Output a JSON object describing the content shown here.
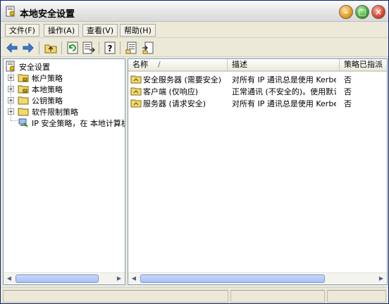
{
  "window": {
    "title": "本地安全设置"
  },
  "menubar": {
    "items": [
      {
        "label": "文件(F)"
      },
      {
        "label": "操作(A)"
      },
      {
        "label": "查看(V)"
      },
      {
        "label": "帮助(H)"
      }
    ]
  },
  "toolbar": {
    "icons": [
      "back-arrow-icon",
      "forward-arrow-icon",
      "up-folder-icon",
      "refresh-icon",
      "export-list-icon",
      "help-icon",
      "properties-icon",
      "import-policy-icon"
    ]
  },
  "tree": {
    "root": "安全设置",
    "items": [
      {
        "label": "帐户策略"
      },
      {
        "label": "本地策略"
      },
      {
        "label": "公钥策略"
      },
      {
        "label": "软件限制策略"
      },
      {
        "label": "IP 安全策略，在 本地计算机"
      }
    ]
  },
  "list": {
    "columns": [
      "名称",
      "描述",
      "策略已指派"
    ],
    "sort_indicator": "/",
    "rows": [
      {
        "name": "安全服务器 (需要安全)",
        "desc": "对所有 IP 通讯总是使用 Kerberos 信任请求安全。",
        "assigned": "否"
      },
      {
        "name": "客户端 (仅响应)",
        "desc": "正常通讯 (不安全的)。使用默认响应规则。",
        "assigned": "否"
      },
      {
        "name": "服务器 (请求安全)",
        "desc": "对所有 IP 通讯总是使用 Kerberos 信任请求安全。",
        "assigned": "否"
      }
    ]
  },
  "colors": {
    "selection": "#316ac5",
    "border": "#7f9db9",
    "face": "#ece9d8"
  }
}
